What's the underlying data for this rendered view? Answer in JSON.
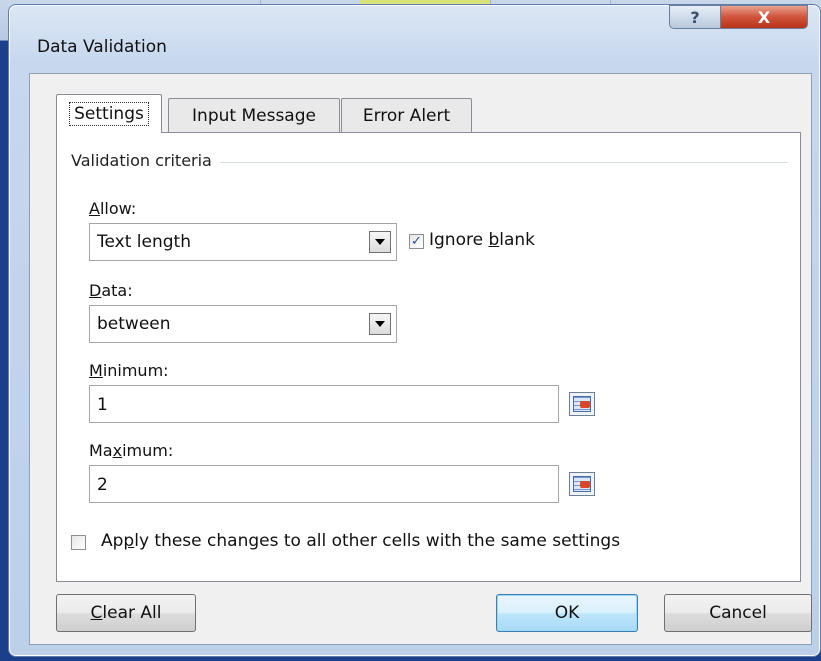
{
  "window": {
    "title": "Data Validation",
    "help_glyph": "?",
    "close_glyph": "X"
  },
  "tabs": [
    {
      "label": "Settings",
      "active": true
    },
    {
      "label": "Input Message",
      "active": false
    },
    {
      "label": "Error Alert",
      "active": false
    }
  ],
  "settings": {
    "section_label": "Validation criteria",
    "allow": {
      "label_access": "A",
      "label_rest": "llow:",
      "value": "Text length"
    },
    "ignore_blank": {
      "checked": true,
      "check_glyph": "✓",
      "label_pre": "Ignore ",
      "label_access": "b",
      "label_post": "lank"
    },
    "data": {
      "label_access": "D",
      "label_rest": "ata:",
      "value": "between"
    },
    "minimum": {
      "label_access": "M",
      "label_rest": "inimum:",
      "value": "1"
    },
    "maximum": {
      "label_pre": "Ma",
      "label_access": "x",
      "label_post": "imum:",
      "value": "2"
    },
    "apply_all": {
      "checked": false,
      "label_pre": "Ap",
      "label_access": "p",
      "label_post": "ly these changes to all other cells with the same settings"
    }
  },
  "buttons": {
    "clear_all": {
      "access": "C",
      "rest": "lear All"
    },
    "ok": "OK",
    "cancel": "Cancel"
  },
  "colors": {
    "accent": "#3c7fb1",
    "close": "#c8452b",
    "check": "#2a4f9b"
  }
}
